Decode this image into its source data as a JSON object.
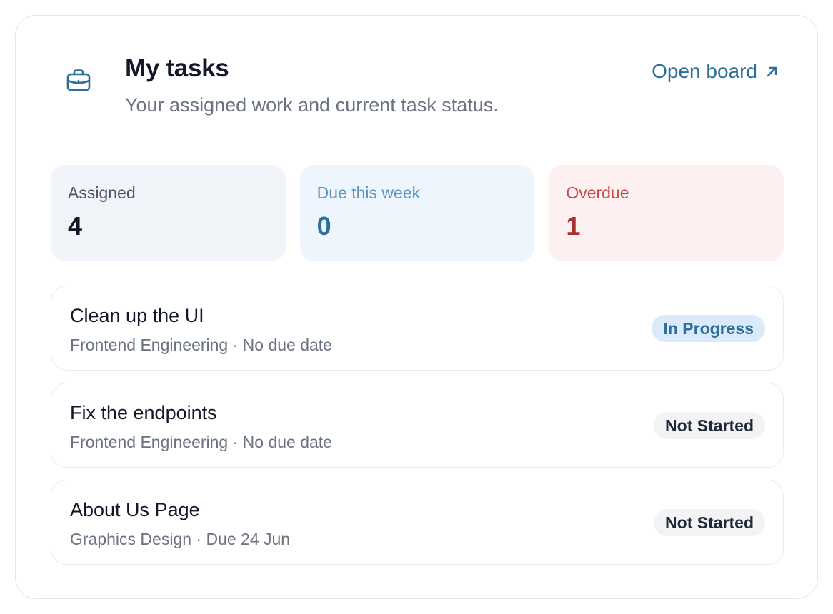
{
  "header": {
    "icon": "briefcase-icon",
    "title": "My tasks",
    "subtitle": "Your assigned work and current task status.",
    "open_board_label": "Open board",
    "open_board_icon": "arrow-up-right-icon"
  },
  "stats": [
    {
      "label": "Assigned",
      "value": "4"
    },
    {
      "label": "Due this week",
      "value": "0"
    },
    {
      "label": "Overdue",
      "value": "1"
    }
  ],
  "tasks": [
    {
      "title": "Clean up the UI",
      "meta": "Frontend Engineering · No due date",
      "status": "In Progress"
    },
    {
      "title": "Fix the endpoints",
      "meta": "Frontend Engineering · No due date",
      "status": "Not Started"
    },
    {
      "title": "About Us Page",
      "meta": "Graphics Design · Due 24 Jun",
      "status": "Not Started"
    }
  ],
  "colors": {
    "accent": "#2e6f99",
    "overdue": "#a8322f",
    "title_text": "#111827",
    "muted_text": "#6b7280",
    "in_progress_badge_bg": "#dbeafb",
    "not_started_badge_bg": "#f2f3f5"
  }
}
